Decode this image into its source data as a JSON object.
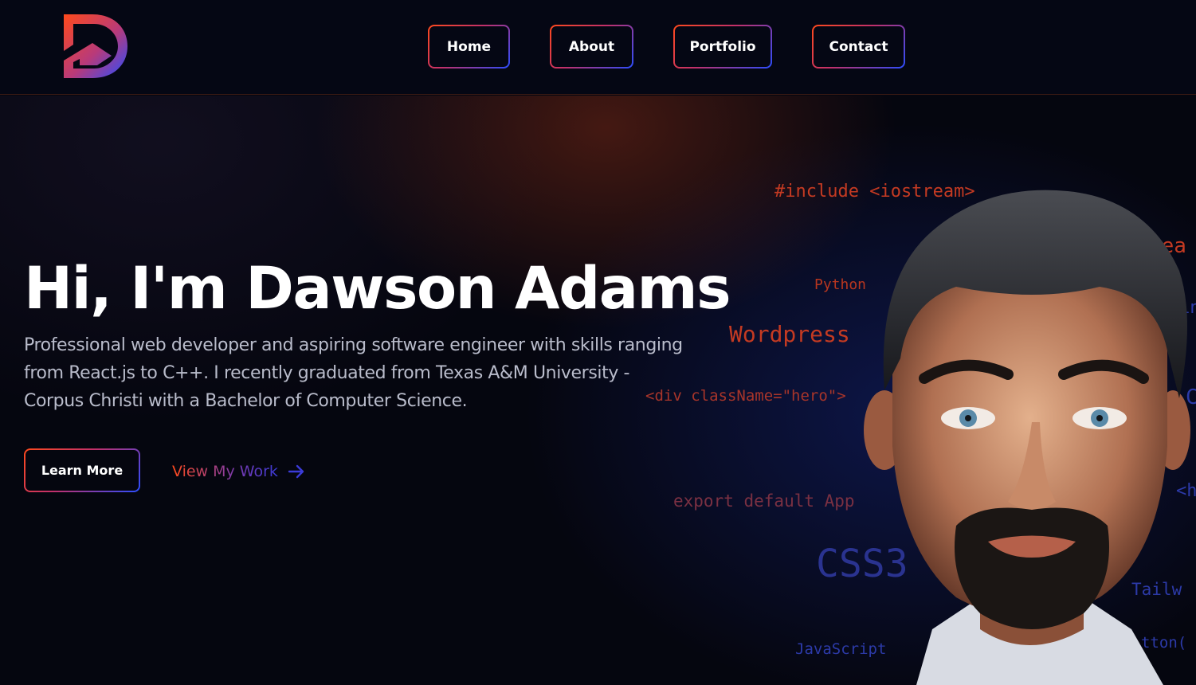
{
  "nav": {
    "logo": "D logo",
    "items": [
      {
        "label": "Home"
      },
      {
        "label": "About"
      },
      {
        "label": "Portfolio"
      },
      {
        "label": "Contact"
      }
    ]
  },
  "hero": {
    "headline": "Hi, I'm Dawson Adams",
    "intro": "Professional web developer and aspiring software engineer with skills ranging from React.js to C++. I recently graduated from Texas A&M University - Corpus Christi with a Bachelor of Computer Science.",
    "learn_more_label": "Learn More",
    "view_work_label": "View My Work",
    "portrait": "portrait of Dawson Adams",
    "code_words": [
      {
        "text": "#include <iostream>"
      },
      {
        "text": "Rea"
      },
      {
        "text": "Python"
      },
      {
        "text": "Wordpress"
      },
      {
        "text": "<div className=\"hero\">"
      },
      {
        "text": "export default App"
      },
      {
        "text": "CSS3"
      },
      {
        "text": "Tailw"
      },
      {
        "text": "JavaScript"
      },
      {
        "text": "tton("
      },
      {
        "text": "<h"
      },
      {
        "text": "in"
      },
      {
        "text": "C"
      }
    ]
  },
  "colors": {
    "accent_orange": "#ff4a1c",
    "accent_blue": "#2a4dff",
    "background": "#05060f",
    "text_muted": "#b9bccb"
  },
  "icons": {
    "arrow": "arrow-right-icon"
  }
}
